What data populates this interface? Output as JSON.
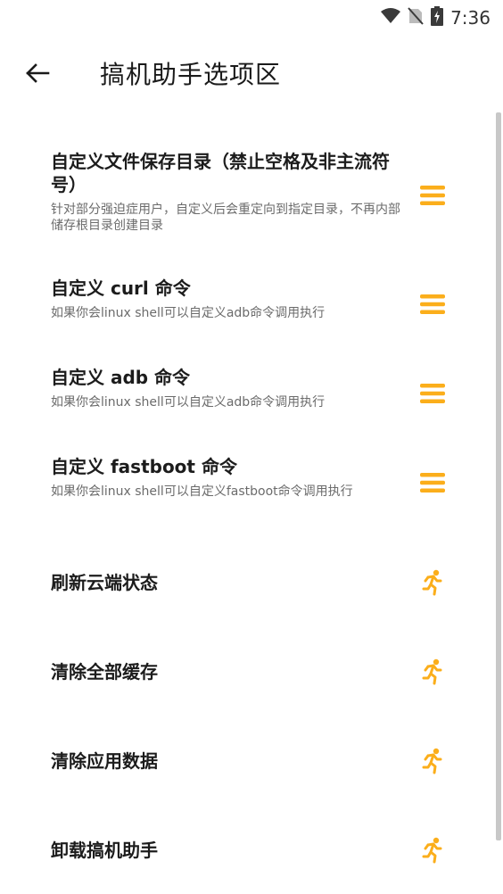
{
  "status_bar": {
    "time": "7:36",
    "icons": [
      "wifi-icon",
      "no-sim-icon",
      "battery-charging-icon"
    ]
  },
  "header": {
    "back_icon": "arrow-left-icon",
    "title": "搞机助手选项区"
  },
  "settings": [
    {
      "title": "自定义文件保存目录（禁止空格及非主流符号）",
      "subtitle": "针对部分强迫症用户，自定义后会重定向到指定目录，不再内部储存根目录创建目录",
      "icon": "menu-icon"
    },
    {
      "title": "自定义 curl 命令",
      "subtitle": "如果你会linux shell可以自定义adb命令调用执行",
      "icon": "menu-icon"
    },
    {
      "title": "自定义 adb 命令",
      "subtitle": "如果你会linux shell可以自定义adb命令调用执行",
      "icon": "menu-icon"
    },
    {
      "title": "自定义 fastboot 命令",
      "subtitle": "如果你会linux shell可以自定义fastboot命令调用执行",
      "icon": "menu-icon"
    },
    {
      "title": "刷新云端状态",
      "icon": "running-person-icon"
    },
    {
      "title": "清除全部缓存",
      "icon": "running-person-icon"
    },
    {
      "title": "清除应用数据",
      "icon": "running-person-icon"
    },
    {
      "title": "卸载搞机助手",
      "icon": "running-person-icon"
    }
  ],
  "colors": {
    "accent": "#FBAE1B",
    "title_text": "#1C1C1C",
    "subtitle_text": "#6B6B6B",
    "background": "#FFFFFF"
  }
}
